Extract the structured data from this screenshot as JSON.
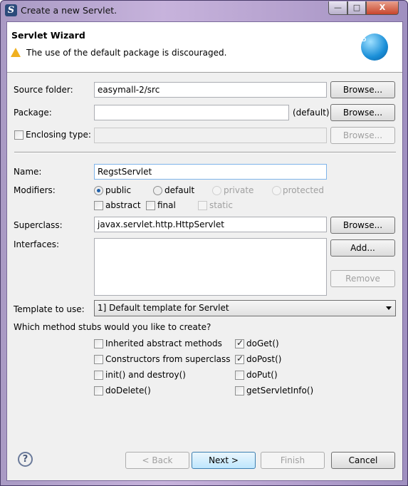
{
  "window": {
    "title": "Create a new Servlet.",
    "minimize": "—",
    "maximize": "□",
    "close": "X"
  },
  "header": {
    "title": "Servlet Wizard",
    "message": "The use of the default package is discouraged.",
    "logo_letter": "S",
    "warning_icon": "warning-triangle"
  },
  "source_folder": {
    "label": "Source folder:",
    "value": "easymall-2/src",
    "browse": "Browse..."
  },
  "package": {
    "label": "Package:",
    "value": "",
    "suffix": "(default)",
    "browse": "Browse..."
  },
  "enclosing_type": {
    "label": "Enclosing type:",
    "checked": false,
    "value": "",
    "browse": "Browse..."
  },
  "name": {
    "label": "Name:",
    "value": "RegstServlet"
  },
  "modifiers": {
    "label": "Modifiers:",
    "radios": [
      {
        "label": "public",
        "selected": true,
        "enabled": true
      },
      {
        "label": "default",
        "selected": false,
        "enabled": true
      },
      {
        "label": "private",
        "selected": false,
        "enabled": false
      },
      {
        "label": "protected",
        "selected": false,
        "enabled": false
      }
    ],
    "checks": [
      {
        "label": "abstract",
        "checked": false,
        "enabled": true
      },
      {
        "label": "final",
        "checked": false,
        "enabled": true
      },
      {
        "label": "static",
        "checked": false,
        "enabled": false
      }
    ]
  },
  "superclass": {
    "label": "Superclass:",
    "value": "javax.servlet.http.HttpServlet",
    "browse": "Browse..."
  },
  "interfaces": {
    "label": "Interfaces:",
    "add": "Add...",
    "remove": "Remove"
  },
  "template": {
    "label": "Template to use:",
    "value": "1] Default template for Servlet"
  },
  "stubs": {
    "question": "Which method stubs would you like to create?",
    "items": [
      {
        "label": "Inherited abstract methods",
        "checked": false
      },
      {
        "label": "doGet()",
        "checked": true
      },
      {
        "label": "Constructors from superclass",
        "checked": false
      },
      {
        "label": "doPost()",
        "checked": true
      },
      {
        "label": "init() and destroy()",
        "checked": false
      },
      {
        "label": "doPut()",
        "checked": false
      },
      {
        "label": "doDelete()",
        "checked": false
      },
      {
        "label": "getServletInfo()",
        "checked": false
      }
    ]
  },
  "footer": {
    "help": "?",
    "back": "< Back",
    "next": "Next >",
    "finish": "Finish",
    "cancel": "Cancel"
  }
}
